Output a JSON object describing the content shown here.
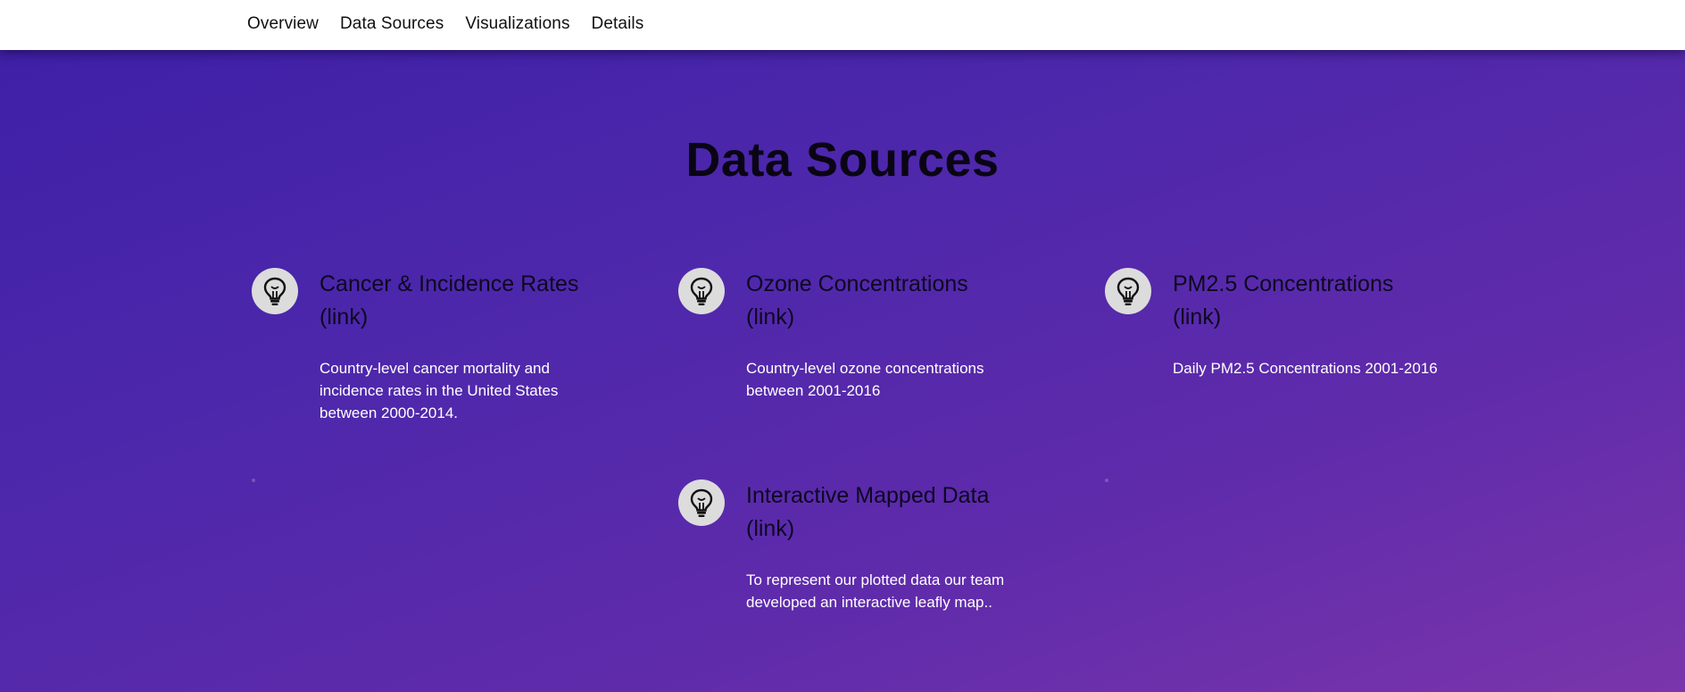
{
  "nav": {
    "items": [
      {
        "label": "Overview"
      },
      {
        "label": "Data Sources"
      },
      {
        "label": "Visualizations"
      },
      {
        "label": "Details"
      }
    ]
  },
  "section": {
    "title": "Data Sources"
  },
  "sources": [
    {
      "title": "Cancer & Incidence Rates",
      "link_label": "(link)",
      "description": "Country-level cancer mortality and incidence rates in the United States between 2000-2014.",
      "icon": "lightbulb-icon"
    },
    {
      "title": "Ozone Concentrations",
      "link_label": "(link)",
      "description": "Country-level ozone concentrations between 2001-2016",
      "icon": "lightbulb-icon"
    },
    {
      "title": "PM2.5 Concentrations",
      "link_label": "(link)",
      "description": "Daily PM2.5 Concentrations 2001-2016",
      "icon": "lightbulb-icon"
    },
    {
      "title": "Interactive Mapped Data",
      "link_label": "(link)",
      "description": "To represent our plotted data our team developed an interactive leafly map..",
      "icon": "lightbulb-icon"
    }
  ],
  "colors": {
    "gradient_start": "#3d1fa6",
    "gradient_end": "#7a35ab",
    "icon_background": "#dcdcdc",
    "navbar": "#ffffff"
  }
}
